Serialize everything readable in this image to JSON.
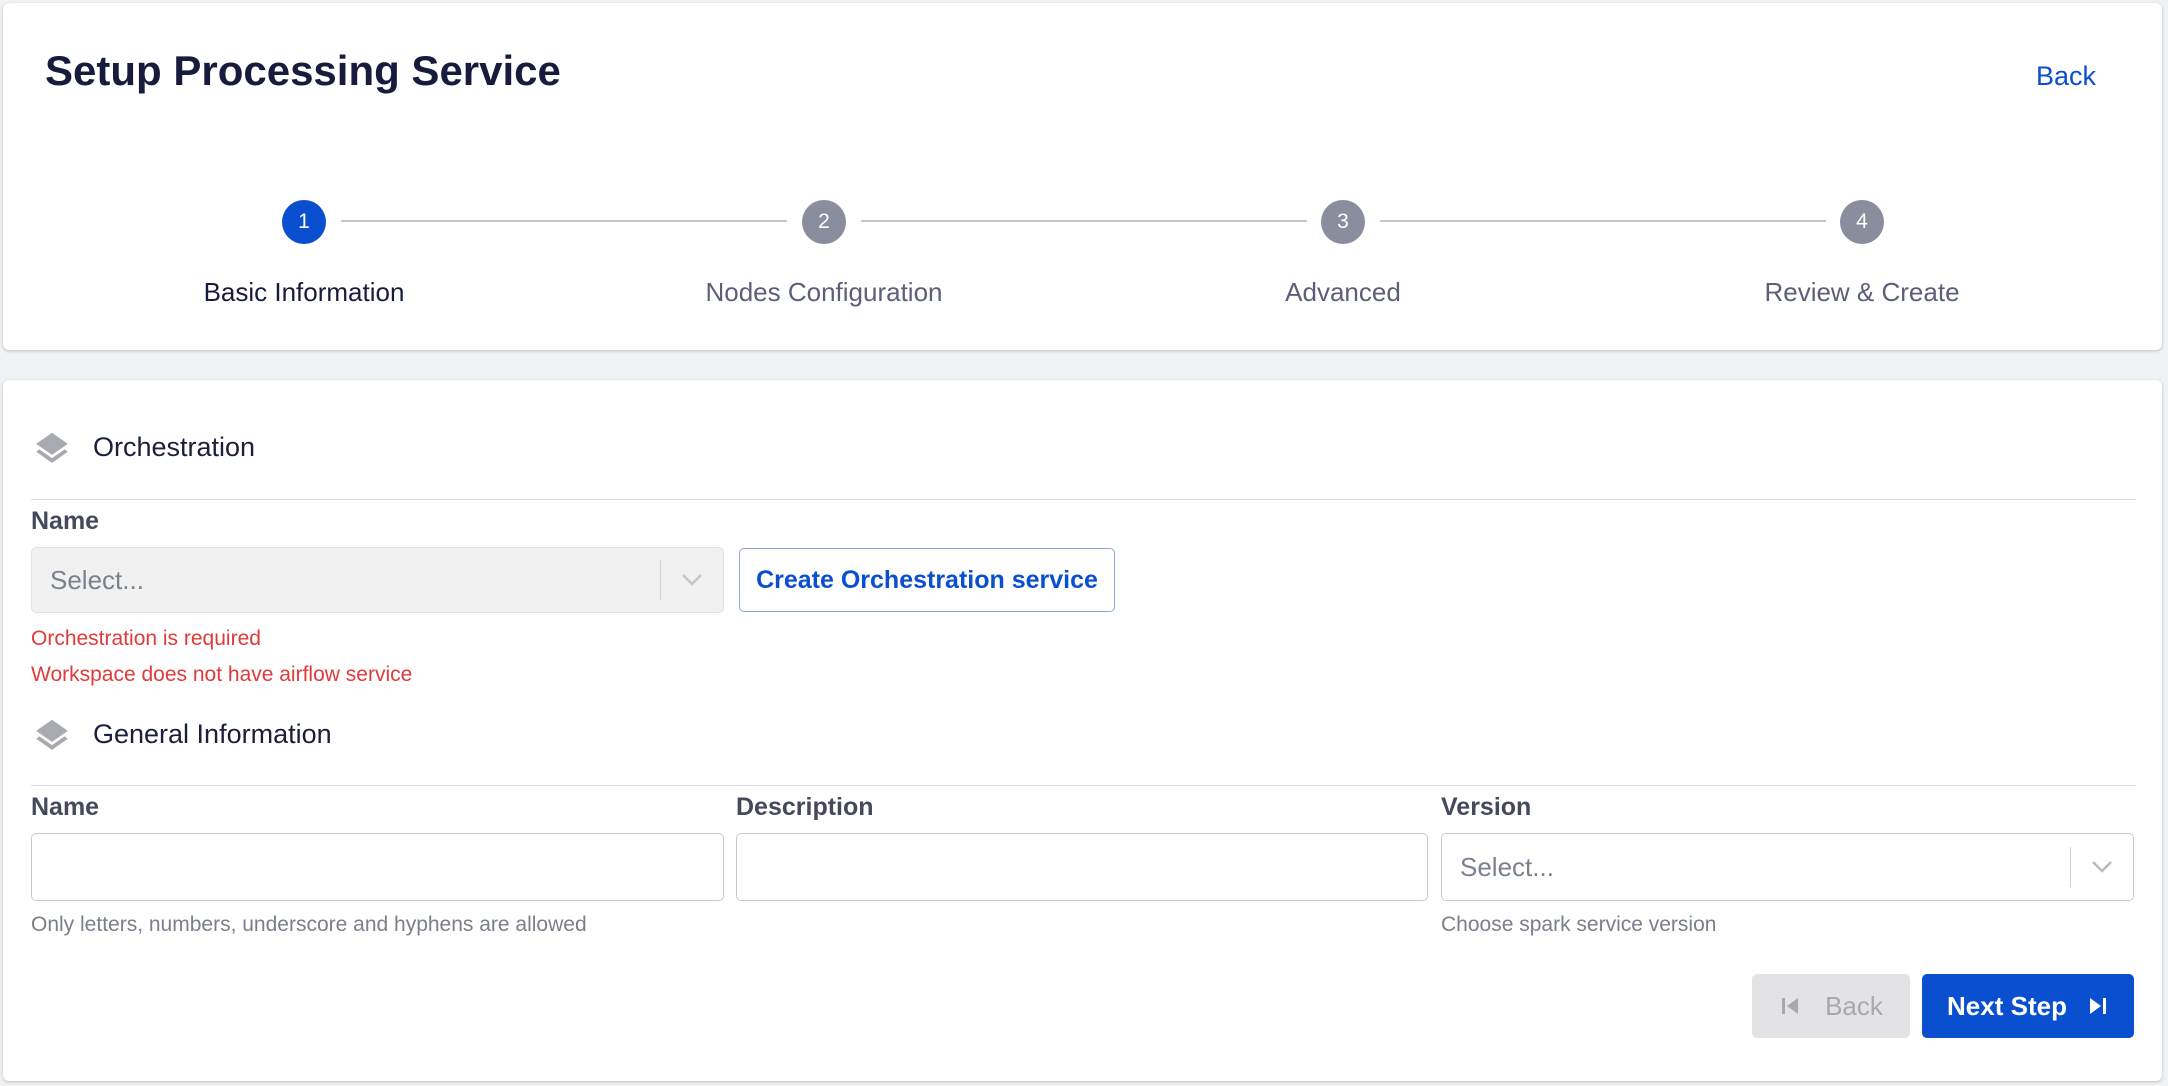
{
  "header": {
    "title": "Setup Processing Service",
    "back_label": "Back"
  },
  "stepper": {
    "steps": [
      {
        "number": "1",
        "label": "Basic Information",
        "active": true
      },
      {
        "number": "2",
        "label": "Nodes Configuration",
        "active": false
      },
      {
        "number": "3",
        "label": "Advanced",
        "active": false
      },
      {
        "number": "4",
        "label": "Review & Create",
        "active": false
      }
    ]
  },
  "orchestration": {
    "section_title": "Orchestration",
    "icon": "layers-icon",
    "name_label": "Name",
    "select_placeholder": "Select...",
    "create_button_label": "Create Orchestration service",
    "errors": [
      "Orchestration is required",
      "Workspace does not have airflow service"
    ]
  },
  "general_information": {
    "section_title": "General Information",
    "icon": "layers-icon",
    "name_label": "Name",
    "name_value": "",
    "name_hint": "Only letters, numbers, underscore and hyphens are allowed",
    "description_label": "Description",
    "description_value": "",
    "version_label": "Version",
    "version_placeholder": "Select...",
    "version_hint": "Choose spark service version"
  },
  "footer": {
    "back_label": "Back",
    "next_label": "Next Step"
  },
  "colors": {
    "primary": "#0a4fd0",
    "error": "#e03a3a",
    "inactive_step": "#8a8d9e"
  }
}
